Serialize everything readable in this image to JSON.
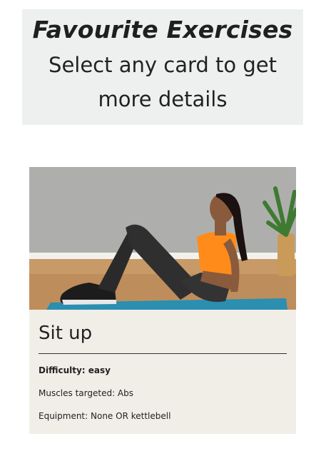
{
  "header": {
    "title": "Favourite Exercises",
    "subtitle_line1": "Select any card to get",
    "subtitle_line2": "more details"
  },
  "card": {
    "title": "Sit up",
    "difficulty": "Difficulty: easy",
    "muscles": "Muscles targeted: Abs",
    "equipment": "Equipment: None OR kettlebell"
  },
  "colors": {
    "header_bg": "#eef0f0",
    "card_bg": "#f1eee8",
    "top_accent": "#ff8c1a",
    "mat": "#2a8fb0"
  }
}
